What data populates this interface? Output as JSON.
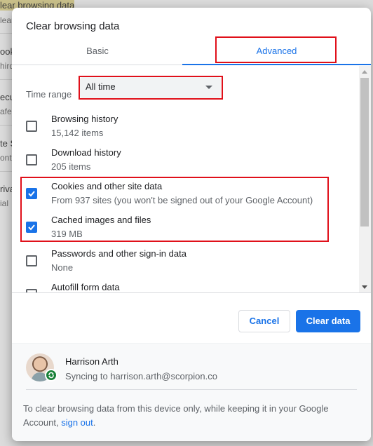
{
  "background_page": {
    "lines": [
      {
        "text": "lear browsing data",
        "highlight": true
      },
      {
        "text": "lear",
        "sub": true
      },
      {
        "text": "ook",
        "sub": false
      },
      {
        "text": "hird",
        "sub": true
      },
      {
        "text": "ecu",
        "sub": false
      },
      {
        "text": "afe",
        "sub": true
      },
      {
        "text": "te S",
        "sub": false
      },
      {
        "text": "ont",
        "sub": true
      },
      {
        "text": "riva",
        "sub": false
      },
      {
        "text": "ial",
        "sub": true
      }
    ]
  },
  "dialog": {
    "title": "Clear browsing data",
    "tabs": [
      {
        "label": "Basic",
        "active": false
      },
      {
        "label": "Advanced",
        "active": true
      }
    ],
    "time_range": {
      "label": "Time range",
      "value": "All time"
    },
    "items": [
      {
        "title": "Browsing history",
        "subtitle": "15,142 items",
        "checked": false
      },
      {
        "title": "Download history",
        "subtitle": "205 items",
        "checked": false
      },
      {
        "title": "Cookies and other site data",
        "subtitle": "From 937 sites (you won't be signed out of your Google Account)",
        "checked": true
      },
      {
        "title": "Cached images and files",
        "subtitle": "319 MB",
        "checked": true
      },
      {
        "title": "Passwords and other sign-in data",
        "subtitle": "None",
        "checked": false
      },
      {
        "title": "Autofill form data",
        "subtitle": "",
        "checked": false
      }
    ],
    "buttons": {
      "cancel": "Cancel",
      "clear": "Clear data"
    },
    "account": {
      "name": "Harrison Arth",
      "sync_status": "Syncing to harrison.arth@scorpion.co"
    },
    "footer_note": {
      "text": "To clear browsing data from this device only, while keeping it in your Google Account, ",
      "link": "sign out",
      "end": "."
    }
  },
  "colors": {
    "accent": "#1a73e8",
    "annotation_red": "#e0101a",
    "sync_green": "#188038"
  }
}
